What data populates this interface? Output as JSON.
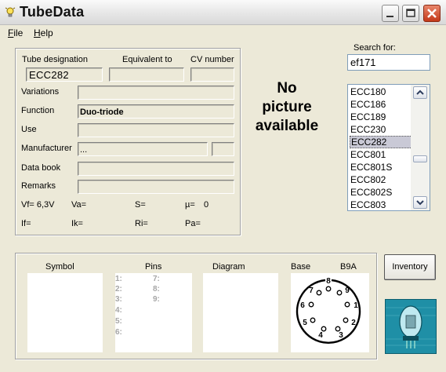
{
  "window": {
    "title": "TubeData"
  },
  "menu": [
    {
      "label": "File",
      "accel": "F",
      "rest": "ile"
    },
    {
      "label": "Help",
      "accel": "H",
      "rest": "elp"
    }
  ],
  "details": {
    "tube_designation_label": "Tube designation",
    "equivalent_label": "Equivalent to",
    "cv_label": "CV number",
    "tube_designation": "ECC282",
    "variations_label": "Variations",
    "function_label": "Function",
    "function_value": "Duo-triode",
    "use_label": "Use",
    "manufacturer_label": "Manufacturer",
    "manufacturer_value": "...",
    "databook_label": "Data book",
    "remarks_label": "Remarks",
    "vf": "Vf= 6,3V",
    "va": "Va=",
    "s": "S=",
    "mu_label": "µ=",
    "mu_value": "0",
    "if": "If=",
    "ik": "Ik=",
    "ri": "Ri=",
    "pa": "Pa="
  },
  "picture": {
    "text_lines": [
      "No",
      "picture",
      "available"
    ]
  },
  "search": {
    "label": "Search for:",
    "value": "ef171"
  },
  "tube_list": {
    "items": [
      "ECC180",
      "ECC186",
      "ECC189",
      "ECC230",
      "ECC282",
      "ECC801",
      "ECC801S",
      "ECC802",
      "ECC802S",
      "ECC803"
    ],
    "selected": "ECC282"
  },
  "bottom": {
    "symbol_label": "Symbol",
    "pins_label": "Pins",
    "diagram_label": "Diagram",
    "base_label": "Base",
    "base_value": "B9A",
    "pins_left": [
      "1:",
      "2:",
      "3:",
      "4:",
      "5:",
      "6:"
    ],
    "pins_right": [
      "7:",
      "8:",
      "9:"
    ],
    "base_pins": [
      "1",
      "2",
      "3",
      "4",
      "5",
      "6",
      "7",
      "8",
      "9"
    ]
  },
  "inventory_button": "Inventory",
  "icons": [
    "app-bulb-icon",
    "minimize-icon",
    "maximize-icon",
    "close-icon",
    "scroll-up-icon",
    "scroll-down-icon",
    "tube-logo-icon"
  ],
  "colors": {
    "close_button": "#c4391a",
    "selection": "#c9c9d6",
    "logo_bg": "#1f8fa6"
  }
}
